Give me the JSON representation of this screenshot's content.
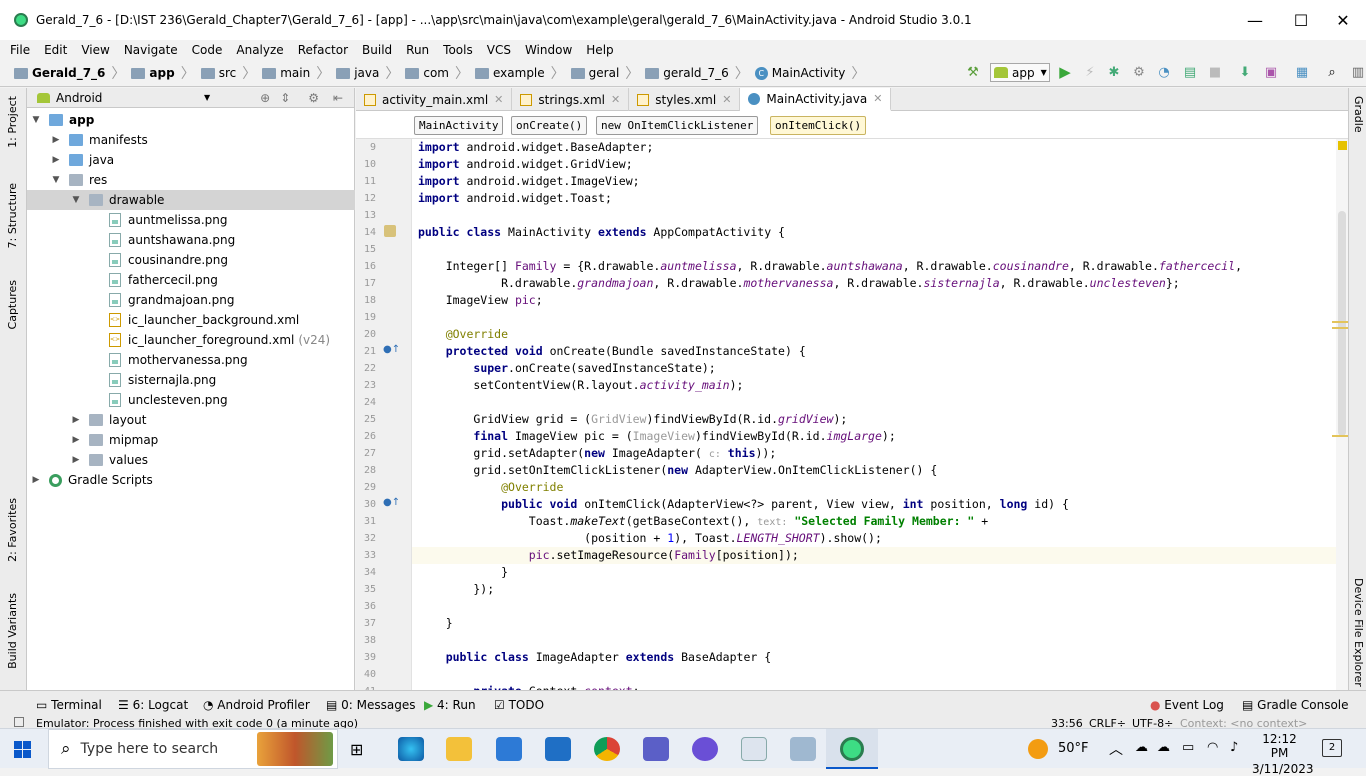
{
  "window": {
    "title": "Gerald_7_6 - [D:\\IST 236\\Gerald_Chapter7\\Gerald_7_6] - [app] - ...\\app\\src\\main\\java\\com\\example\\geral\\gerald_7_6\\MainActivity.java - Android Studio 3.0.1",
    "min": "—",
    "max": "☐",
    "close": "✕"
  },
  "menu": [
    "File",
    "Edit",
    "View",
    "Navigate",
    "Code",
    "Analyze",
    "Refactor",
    "Build",
    "Run",
    "Tools",
    "VCS",
    "Window",
    "Help"
  ],
  "breadcrumb": [
    "Gerald_7_6",
    "app",
    "src",
    "main",
    "java",
    "com",
    "example",
    "geral",
    "gerald_7_6",
    "MainActivity"
  ],
  "toolbar": {
    "run_config": "app"
  },
  "left_tabs": [
    "1: Project",
    "7: Structure",
    "Captures",
    "2: Favorites",
    "Build Variants"
  ],
  "right_tabs": [
    "Gradle",
    "Device File Explorer"
  ],
  "project": {
    "view_mode": "Android",
    "tree": [
      {
        "label": "app",
        "depth": 0,
        "arrow": "▼",
        "kind": "folder-blue",
        "bold": true
      },
      {
        "label": "manifests",
        "depth": 1,
        "arrow": "▶",
        "kind": "folder-blue"
      },
      {
        "label": "java",
        "depth": 1,
        "arrow": "▶",
        "kind": "folder-blue"
      },
      {
        "label": "res",
        "depth": 1,
        "arrow": "▼",
        "kind": "folder-grey"
      },
      {
        "label": "drawable",
        "depth": 2,
        "arrow": "▼",
        "kind": "folder-grey",
        "selected": true
      },
      {
        "label": "auntmelissa.png",
        "depth": 3,
        "arrow": "",
        "kind": "img"
      },
      {
        "label": "auntshawana.png",
        "depth": 3,
        "arrow": "",
        "kind": "img"
      },
      {
        "label": "cousinandre.png",
        "depth": 3,
        "arrow": "",
        "kind": "img"
      },
      {
        "label": "fathercecil.png",
        "depth": 3,
        "arrow": "",
        "kind": "img"
      },
      {
        "label": "grandmajoan.png",
        "depth": 3,
        "arrow": "",
        "kind": "img"
      },
      {
        "label": "ic_launcher_background.xml",
        "depth": 3,
        "arrow": "",
        "kind": "xml"
      },
      {
        "label": "ic_launcher_foreground.xml",
        "depth": 3,
        "arrow": "",
        "kind": "xml",
        "suffix": "(v24)"
      },
      {
        "label": "mothervanessa.png",
        "depth": 3,
        "arrow": "",
        "kind": "img"
      },
      {
        "label": "sisternajla.png",
        "depth": 3,
        "arrow": "",
        "kind": "img"
      },
      {
        "label": "unclesteven.png",
        "depth": 3,
        "arrow": "",
        "kind": "img"
      },
      {
        "label": "layout",
        "depth": 2,
        "arrow": "▶",
        "kind": "folder-grey"
      },
      {
        "label": "mipmap",
        "depth": 2,
        "arrow": "▶",
        "kind": "folder-grey"
      },
      {
        "label": "values",
        "depth": 2,
        "arrow": "▶",
        "kind": "folder-grey"
      },
      {
        "label": "Gradle Scripts",
        "depth": 0,
        "arrow": "▶",
        "kind": "gradle"
      }
    ]
  },
  "editor_tabs": [
    {
      "label": "activity_main.xml",
      "active": false
    },
    {
      "label": "strings.xml",
      "active": false
    },
    {
      "label": "styles.xml",
      "active": false
    },
    {
      "label": "MainActivity.java",
      "active": true
    }
  ],
  "code_breadcrumbs": [
    "MainActivity",
    "onCreate()",
    "new OnItemClickListener",
    "onItemClick()"
  ],
  "code": [
    {
      "n": "9",
      "html": "<span class=\"kw\">import</span> android.widget.BaseAdapter;"
    },
    {
      "n": "10",
      "html": "<span class=\"kw\">import</span> android.widget.GridView;"
    },
    {
      "n": "11",
      "html": "<span class=\"kw\">import</span> android.widget.ImageView;"
    },
    {
      "n": "12",
      "html": "<span class=\"kw\">import</span> android.widget.Toast;"
    },
    {
      "n": "13",
      "html": ""
    },
    {
      "n": "14",
      "html": "<span class=\"kw\">public class</span> MainActivity <span class=\"kw\">extends</span> AppCompatActivity {"
    },
    {
      "n": "15",
      "html": ""
    },
    {
      "n": "16",
      "html": "    Integer[] <span class=\"fld\" style=\"font-style:normal\">Family</span> = {R.drawable.<span class=\"fld\">auntmelissa</span>, R.drawable.<span class=\"fld\">auntshawana</span>, R.drawable.<span class=\"fld\">cousinandre</span>, R.drawable.<span class=\"fld\">fathercecil</span>,"
    },
    {
      "n": "17",
      "html": "            R.drawable.<span class=\"fld\">grandmajoan</span>, R.drawable.<span class=\"fld\">mothervanessa</span>, R.drawable.<span class=\"fld\">sisternajla</span>, R.drawable.<span class=\"fld\">unclesteven</span>};"
    },
    {
      "n": "18",
      "html": "    ImageView <span class=\"fld\" style=\"font-style:normal\">pic</span>;"
    },
    {
      "n": "19",
      "html": ""
    },
    {
      "n": "20",
      "html": "    <span class=\"ann\">@Override</span>"
    },
    {
      "n": "21",
      "html": "    <span class=\"kw\">protected void</span> onCreate(Bundle savedInstanceState) {"
    },
    {
      "n": "22",
      "html": "        <span class=\"kw\">super</span>.onCreate(savedInstanceState);"
    },
    {
      "n": "23",
      "html": "        setContentView(R.layout.<span class=\"fld\">activity_main</span>);"
    },
    {
      "n": "24",
      "html": ""
    },
    {
      "n": "25",
      "html": "        GridView grid = (<span style=\"color:#999\">GridView</span>)findViewById(R.id.<span class=\"fld\">gridView</span>);"
    },
    {
      "n": "26",
      "html": "        <span class=\"kw\">final</span> ImageView pic = (<span style=\"color:#999\">ImageView</span>)findViewById(R.id.<span class=\"fld\">imgLarge</span>);"
    },
    {
      "n": "27",
      "html": "        grid.setAdapter(<span class=\"kw\">new</span> ImageAdapter( <span class=\"hint\">c:</span> <span class=\"kw\">this</span>));"
    },
    {
      "n": "28",
      "html": "        grid.setOnItemClickListener(<span class=\"kw\">new</span> AdapterView.OnItemClickListener() {"
    },
    {
      "n": "29",
      "html": "            <span class=\"ann\">@Override</span>"
    },
    {
      "n": "30",
      "html": "            <span class=\"kw\">public void</span> onItemClick(AdapterView&lt;?&gt; parent, View view, <span class=\"kw\">int</span> position, <span class=\"kw\">long</span> id) {"
    },
    {
      "n": "31",
      "html": "                Toast.<span style=\"font-style:italic\">makeText</span>(getBaseContext(), <span class=\"hint\">text:</span> <span class=\"str\">\"Selected Family Member: \"</span> +"
    },
    {
      "n": "32",
      "html": "                        (position + <span style=\"color:#0000ff\">1</span>), Toast.<span class=\"fld\">LENGTH_SHORT</span>).show();"
    },
    {
      "n": "33",
      "html": "                <span class=\"fld\" style=\"font-style:normal\">pic</span>.setImageResource(<span class=\"fld\" style=\"font-style:normal\">Family</span>[position]);",
      "current": true
    },
    {
      "n": "34",
      "html": "            }"
    },
    {
      "n": "35",
      "html": "        });"
    },
    {
      "n": "36",
      "html": ""
    },
    {
      "n": "37",
      "html": "    }"
    },
    {
      "n": "38",
      "html": ""
    },
    {
      "n": "39",
      "html": "    <span class=\"kw\">public class</span> ImageAdapter <span class=\"kw\">extends</span> BaseAdapter {"
    },
    {
      "n": "40",
      "html": ""
    },
    {
      "n": "41",
      "html": "        <span class=\"kw\">private</span> Context <span class=\"fld\" style=\"font-style:normal\">context</span>;"
    }
  ],
  "bottom_tools": {
    "terminal": "Terminal",
    "logcat": "6: Logcat",
    "profiler": "Android Profiler",
    "messages": "0: Messages",
    "run": "4: Run",
    "todo": "TODO",
    "eventlog": "Event Log",
    "gradleconsole": "Gradle Console"
  },
  "status": {
    "message": "Emulator: Process finished with exit code 0 (a minute ago)",
    "position": "33:56",
    "line_sep": "CRLF÷",
    "encoding": "UTF-8÷",
    "context": "Context: <no context>"
  },
  "taskbar": {
    "search_placeholder": "Type here to search",
    "weather": "50°F",
    "time": "12:12 PM",
    "date": "3/11/2023",
    "notif_count": "2"
  }
}
